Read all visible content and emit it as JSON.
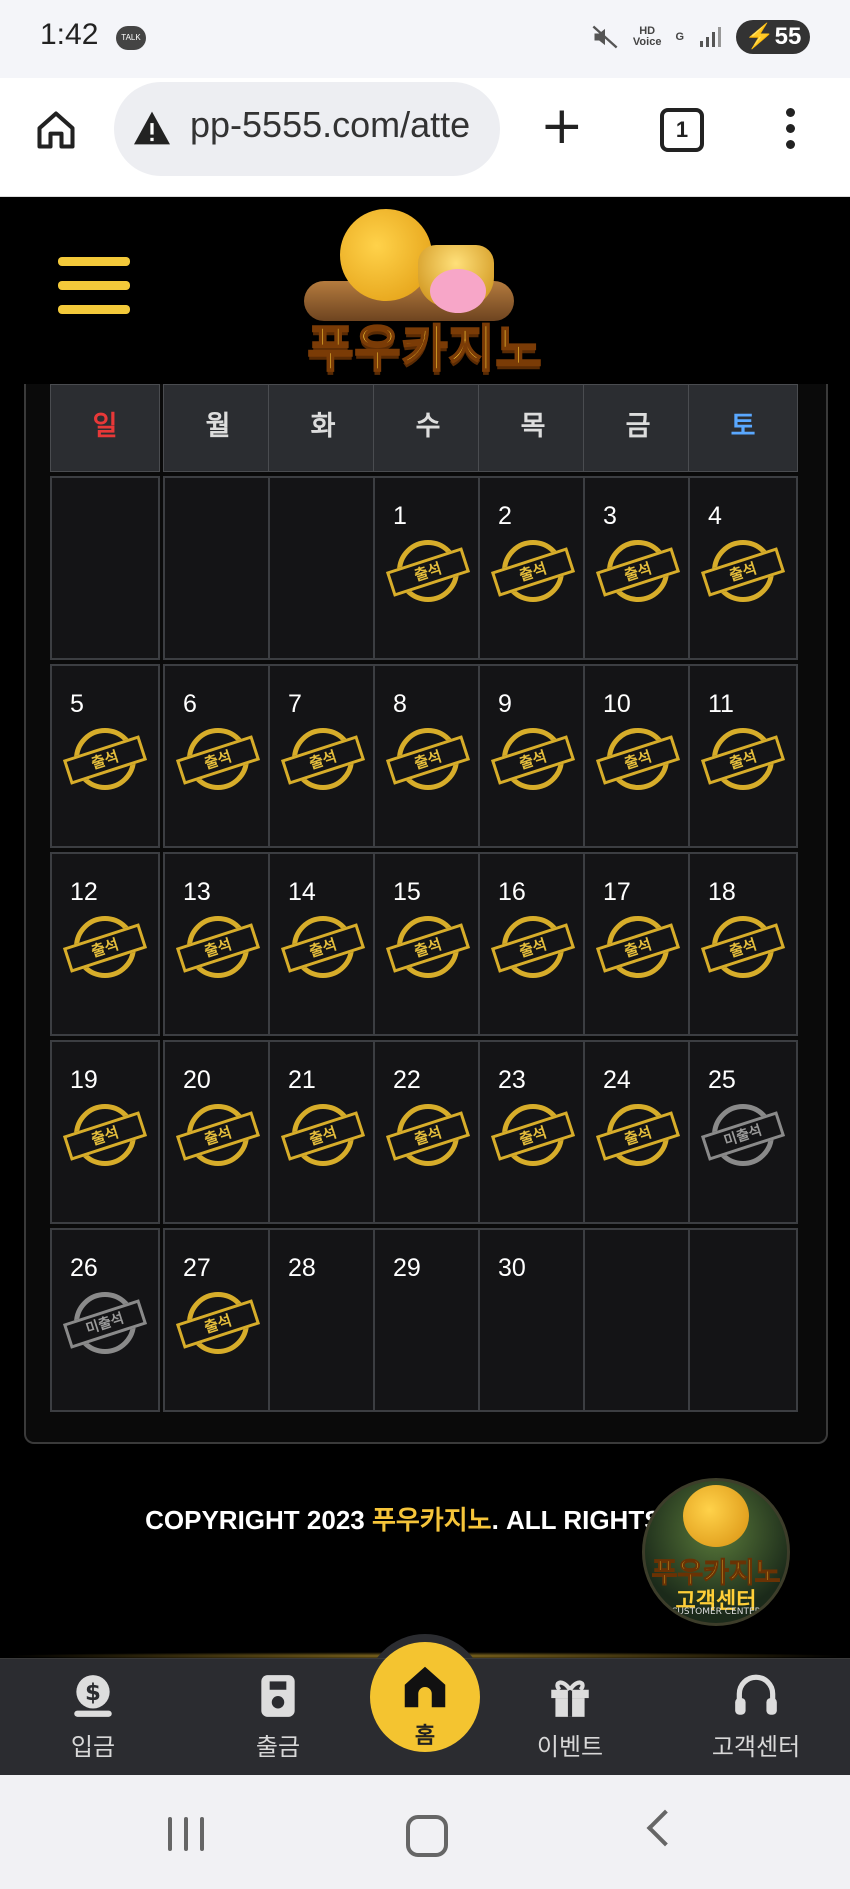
{
  "status_bar": {
    "time": "1:42",
    "talk_badge": "TALK",
    "hd_label": "HD",
    "voice_label": "Voice",
    "net_label": "G",
    "battery": "55"
  },
  "browser": {
    "url": "pp-5555.com/atte",
    "tab_count": "1"
  },
  "site": {
    "brand": "푸우카지노"
  },
  "calendar": {
    "weekdays": [
      "일",
      "월",
      "화",
      "수",
      "목",
      "금",
      "토"
    ],
    "weekday_colors": {
      "sunday": "#e83838",
      "weekday": "#dddddd",
      "saturday": "#5aa8ff"
    },
    "stamp_labels": {
      "attended": "출석",
      "missed": "미출석"
    },
    "weeks": [
      [
        null,
        null,
        null,
        {
          "day": "1",
          "status": "attended"
        },
        {
          "day": "2",
          "status": "attended"
        },
        {
          "day": "3",
          "status": "attended"
        },
        {
          "day": "4",
          "status": "attended"
        }
      ],
      [
        {
          "day": "5",
          "status": "attended"
        },
        {
          "day": "6",
          "status": "attended"
        },
        {
          "day": "7",
          "status": "attended"
        },
        {
          "day": "8",
          "status": "attended"
        },
        {
          "day": "9",
          "status": "attended"
        },
        {
          "day": "10",
          "status": "attended"
        },
        {
          "day": "11",
          "status": "attended"
        }
      ],
      [
        {
          "day": "12",
          "status": "attended"
        },
        {
          "day": "13",
          "status": "attended"
        },
        {
          "day": "14",
          "status": "attended"
        },
        {
          "day": "15",
          "status": "attended"
        },
        {
          "day": "16",
          "status": "attended"
        },
        {
          "day": "17",
          "status": "attended"
        },
        {
          "day": "18",
          "status": "attended"
        }
      ],
      [
        {
          "day": "19",
          "status": "attended"
        },
        {
          "day": "20",
          "status": "attended"
        },
        {
          "day": "21",
          "status": "attended"
        },
        {
          "day": "22",
          "status": "attended"
        },
        {
          "day": "23",
          "status": "attended"
        },
        {
          "day": "24",
          "status": "attended"
        },
        {
          "day": "25",
          "status": "missed"
        }
      ],
      [
        {
          "day": "26",
          "status": "missed"
        },
        {
          "day": "27",
          "status": "attended"
        },
        {
          "day": "28",
          "status": "none"
        },
        {
          "day": "29",
          "status": "none"
        },
        {
          "day": "30",
          "status": "none"
        },
        null,
        null
      ]
    ]
  },
  "footer": {
    "copyright_prefix": "COPYRIGHT 2023 ",
    "copyright_brand": "푸우카지노",
    "copyright_suffix": ". ALL RIGHTS RE"
  },
  "customer_center": {
    "title": "푸우카지노",
    "subtitle": "고객센터",
    "caption": "CUSTOMER CENTER"
  },
  "bottom_nav": {
    "deposit": "입금",
    "withdraw": "출금",
    "home": "홈",
    "event": "이벤트",
    "support": "고객센터"
  },
  "colors": {
    "accent": "#f4c430",
    "stamp_gold": "#d7ad2a",
    "stamp_gray": "#8a8a8a"
  }
}
